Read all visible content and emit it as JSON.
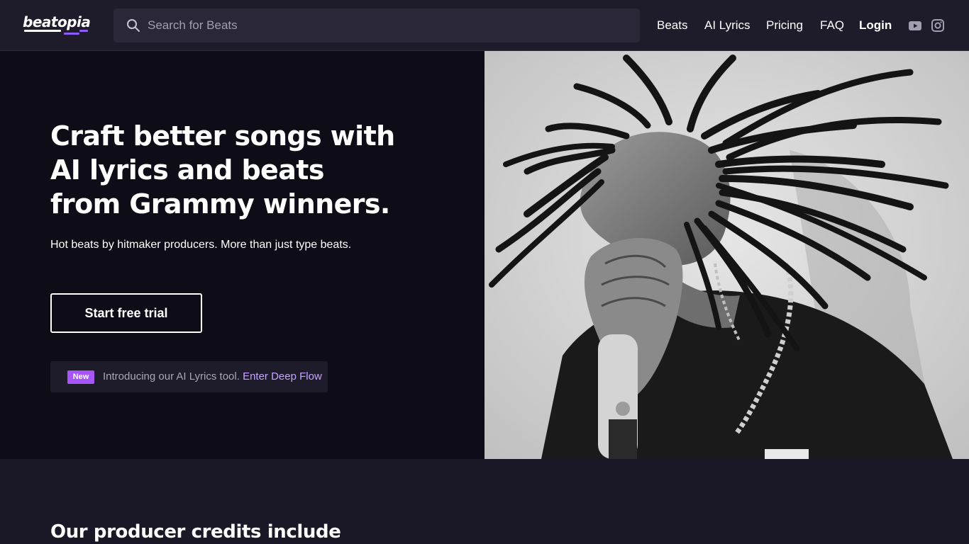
{
  "header": {
    "logo_text": "beatopia",
    "search_placeholder": "Search for Beats",
    "search_value": "",
    "nav": {
      "beats": "Beats",
      "ai_lyrics": "AI Lyrics",
      "pricing": "Pricing",
      "faq": "FAQ",
      "login": "Login"
    },
    "social": [
      "youtube-icon",
      "instagram-icon"
    ]
  },
  "hero": {
    "title_lines": [
      "Craft better songs with",
      "AI lyrics and beats",
      "from Grammy winners."
    ],
    "subtitle": "Hot beats by hitmaker producers. More than just type beats.",
    "cta_label": "Start free trial",
    "promo": {
      "badge": "New",
      "text": "Introducing our AI Lyrics tool.",
      "link": "Enter Deep Flow"
    }
  },
  "credits": {
    "title": "Our producer credits include"
  },
  "colors": {
    "header_bg": "#1e1c2b",
    "hero_bg": "#0e0c16",
    "accent": "#a855f7",
    "link": "#c4a4ff"
  }
}
